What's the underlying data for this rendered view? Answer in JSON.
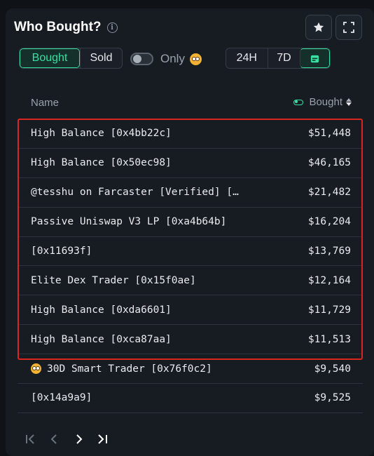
{
  "header": {
    "title": "Who Bought?",
    "info_icon": "info-icon",
    "star_icon": "star-icon",
    "expand_icon": "expand-icon"
  },
  "filters": {
    "side_tabs": [
      {
        "label": "Bought",
        "active": true
      },
      {
        "label": "Sold",
        "active": false
      }
    ],
    "only_toggle": {
      "label": "Only",
      "on": false,
      "emoji_icon": "smart-trader-emoji-icon"
    },
    "time_tabs": [
      {
        "label": "24H",
        "active": false
      },
      {
        "label": "7D",
        "active": false
      },
      {
        "label": "",
        "icon": "calendar-icon",
        "active": true
      }
    ]
  },
  "table": {
    "columns": {
      "name": "Name",
      "bought": "Bought"
    },
    "rows": [
      {
        "name": "High Balance [0x4bb22c]",
        "amount": "$51,448",
        "highlighted": true
      },
      {
        "name": "High Balance [0x50ec98]",
        "amount": "$46,165",
        "highlighted": true
      },
      {
        "name": "@tesshu on Farcaster [Verified] […",
        "amount": "$21,482",
        "highlighted": true
      },
      {
        "name": "Passive Uniswap V3 LP [0xa4b64b]",
        "amount": "$16,204",
        "highlighted": true
      },
      {
        "name": "[0x11693f]",
        "amount": "$13,769",
        "highlighted": true
      },
      {
        "name": "Elite Dex Trader [0x15f0ae]",
        "amount": "$12,164",
        "highlighted": true
      },
      {
        "name": "High Balance [0xda6601]",
        "amount": "$11,729",
        "highlighted": true
      },
      {
        "name": "High Balance [0xca87aa]",
        "amount": "$11,513",
        "highlighted": true
      },
      {
        "name": "30D Smart Trader [0x76f0c2]",
        "amount": "$9,540",
        "emoji": "smart-trader-emoji-icon",
        "highlighted": false
      },
      {
        "name": "[0x14a9a9]",
        "amount": "$9,525",
        "highlighted": false
      }
    ]
  },
  "pagination": {
    "icons": [
      "first-page-icon",
      "prev-page-icon",
      "next-page-icon",
      "last-page-icon"
    ]
  },
  "colors": {
    "accent": "#35e0a1",
    "highlight_border": "#d8271f",
    "panel_bg": "#171c23"
  }
}
